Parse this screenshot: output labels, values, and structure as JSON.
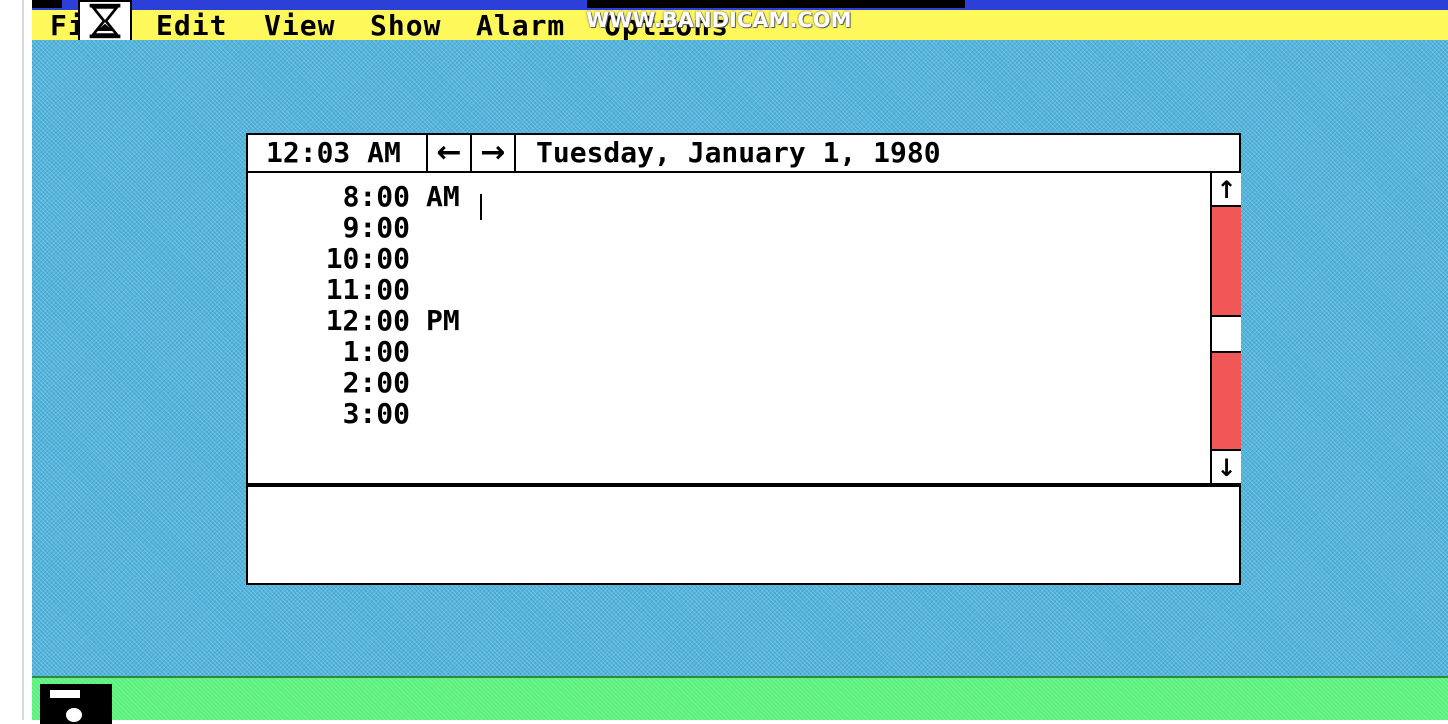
{
  "menubar": {
    "items": [
      {
        "label": "Fi"
      },
      {
        "label": "Edit"
      },
      {
        "label": "View"
      },
      {
        "label": "Show"
      },
      {
        "label": "Alarm"
      },
      {
        "label": "Options"
      }
    ]
  },
  "watermark": "WWW.BANDICAM.COM",
  "calendar": {
    "current_time": "12:03 AM",
    "nav_prev": "←",
    "nav_next": "→",
    "date": "Tuesday, January 1, 1980",
    "hours": [
      {
        "time": "8:00",
        "ampm": "AM"
      },
      {
        "time": "9:00",
        "ampm": ""
      },
      {
        "time": "10:00",
        "ampm": ""
      },
      {
        "time": "11:00",
        "ampm": ""
      },
      {
        "time": "12:00",
        "ampm": "PM"
      },
      {
        "time": "1:00",
        "ampm": ""
      },
      {
        "time": "2:00",
        "ampm": ""
      },
      {
        "time": "3:00",
        "ampm": ""
      }
    ],
    "scroll_up": "↑",
    "scroll_down": "↓"
  },
  "colors": {
    "menubar": "#fff85a",
    "workspace": "#52b6dc",
    "scrollbar": "#f25757",
    "icon_area": "#5cf07e",
    "title_bar": "#2c3fd8"
  }
}
